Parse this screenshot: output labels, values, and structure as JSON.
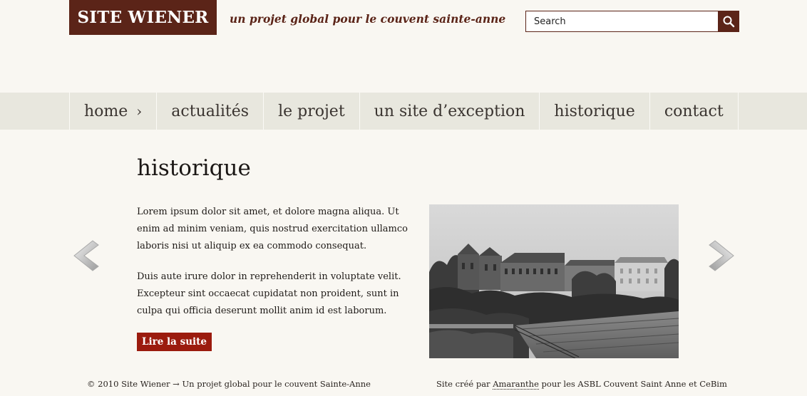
{
  "header": {
    "logo_text": "SITE WIENER",
    "tagline": "un projet global pour le couvent sainte-anne",
    "search": {
      "placeholder": "Search",
      "value": "",
      "button_icon": "magnifier-icon"
    }
  },
  "nav": {
    "items": [
      {
        "label": "home",
        "active": true,
        "suffix": "›"
      },
      {
        "label": "actualités"
      },
      {
        "label": "le projet"
      },
      {
        "label": "un site d’exception"
      },
      {
        "label": "historique"
      },
      {
        "label": "contact"
      }
    ]
  },
  "main": {
    "title": "historique",
    "paragraphs": [
      "Lorem ipsum dolor sit amet, et dolore magna aliqua. Ut enim ad minim veniam, quis nostrud exercitation ullamco laboris nisi ut aliquip ex ea commodo consequat.",
      "Duis aute irure dolor in reprehenderit in voluptate velit. Excepteur sint occaecat cupidatat non proident, sunt in culpa qui officia deserunt mollit anim id est laborum."
    ],
    "read_more_label": "Lire la suite",
    "prev_icon": "chevron-left-icon",
    "next_icon": "chevron-right-icon"
  },
  "footer": {
    "left_text": "© 2010 Site Wiener → Un projet global pour le couvent Sainte-Anne",
    "right_prefix": "Site créé par ",
    "right_link": "Amaranthe",
    "right_suffix": " pour les ASBL Couvent Saint Anne et CeBim"
  },
  "colors": {
    "brand": "#5b2418",
    "button": "#9b1b0e",
    "nav_background": "#e8e7de",
    "page_background": "#f9f7f2"
  }
}
